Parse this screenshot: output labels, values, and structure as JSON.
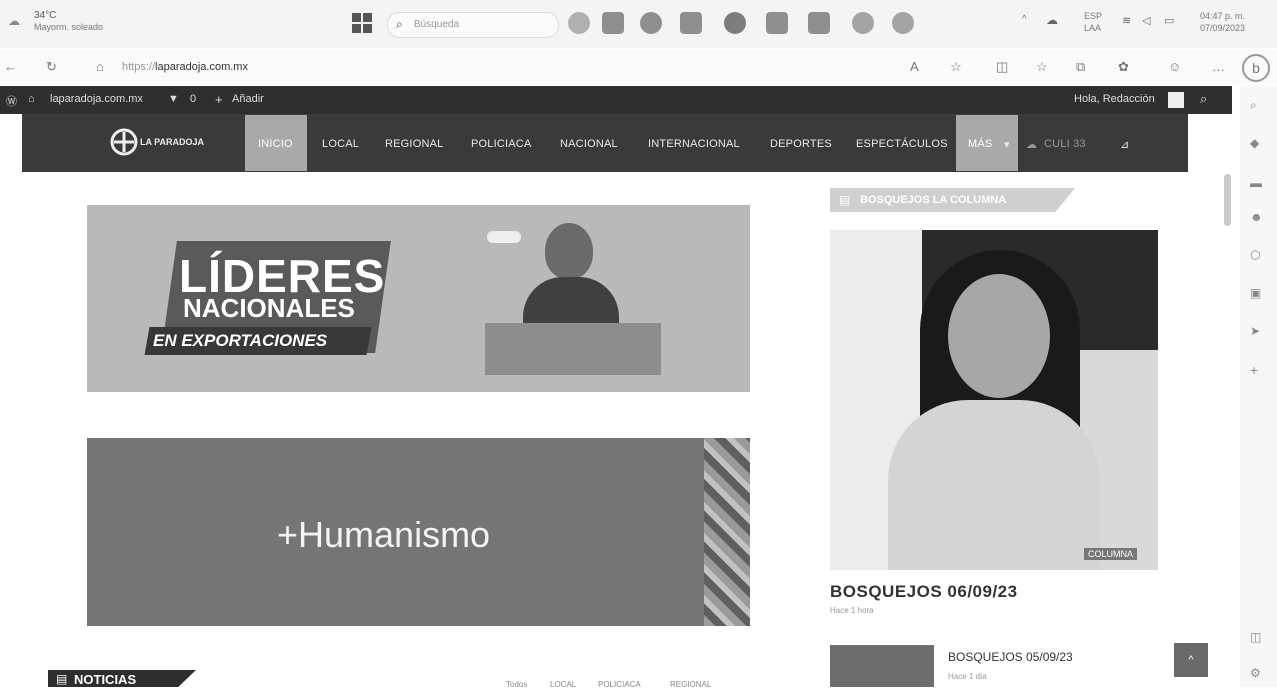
{
  "taskbar": {
    "weather_temp": "34°C",
    "weather_desc": "Mayorm. soleado",
    "search_placeholder": "Búsqueda",
    "lang_top": "ESP",
    "lang_bottom": "LAA",
    "time": "04:47 p. m.",
    "date": "07/09/2023"
  },
  "browser": {
    "url_prefix": "https://",
    "url_domain": "laparadoja.com.mx"
  },
  "adminbar": {
    "site": "laparadoja.com.mx",
    "comments": "0",
    "add_new": "Añadir",
    "greeting": "Hola, Redacción"
  },
  "nav": {
    "logo_text": "LA PARADOJA",
    "items": [
      "INICIO",
      "LOCAL",
      "REGIONAL",
      "POLICIACA",
      "NACIONAL",
      "INTERNACIONAL",
      "DEPORTES",
      "ESPECTÁCULOS",
      "MÁS"
    ],
    "weather": "CULI 33"
  },
  "banner1": {
    "line1": "LÍDERES",
    "line2": "NACIONALES",
    "line3": "EN EXPORTACIONES"
  },
  "banner2": {
    "text": "+Humanismo"
  },
  "sidebar": {
    "section_title": "BOSQUEJOS LA COLUMNA",
    "photo_badge": "COLUMNA",
    "article1_title": "BOSQUEJOS 06/09/23",
    "article1_meta": "Hace 1 hora",
    "article2_title": "BOSQUEJOS 05/09/23",
    "article2_meta": "Hace 1 día"
  },
  "news": {
    "section_title": "NOTICIAS",
    "tabs": [
      "Todos",
      "LOCAL",
      "POLICIACA",
      "REGIONAL"
    ]
  }
}
